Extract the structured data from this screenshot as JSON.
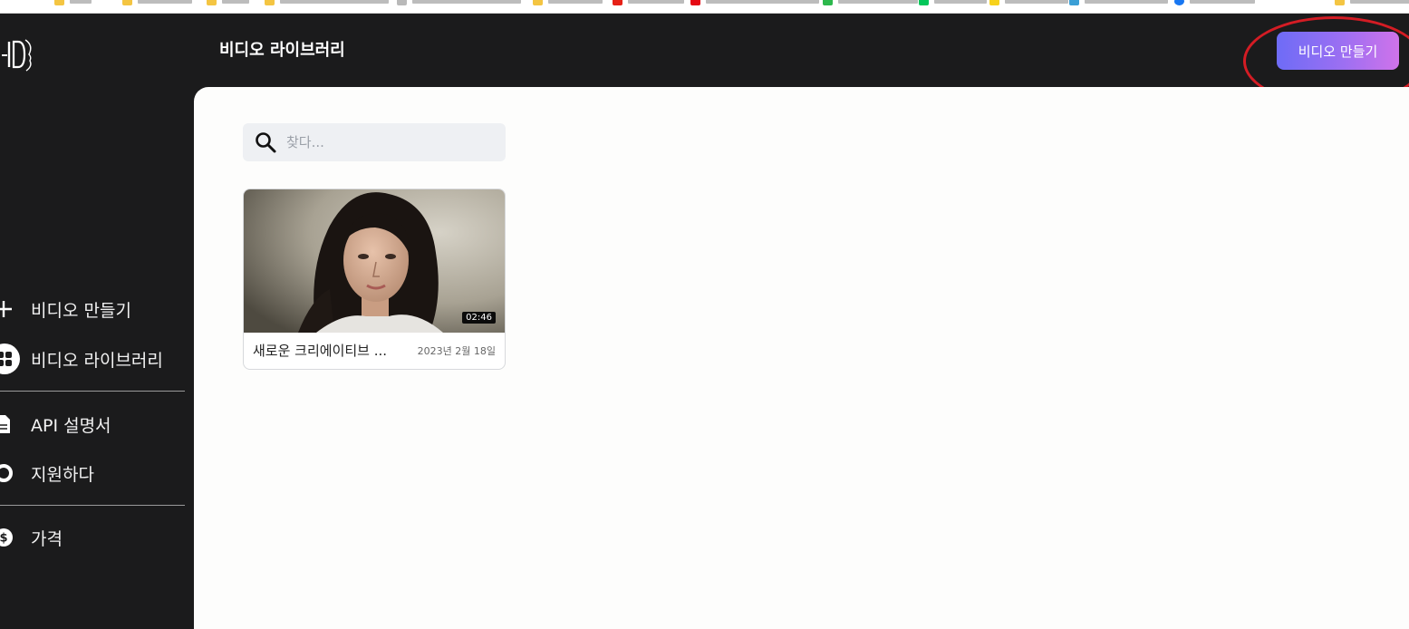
{
  "header": {
    "title": "비디오 라이브러리",
    "create_button": "비디오 만들기"
  },
  "sidebar": {
    "items": [
      {
        "label": "비디오 만들기",
        "icon": "plus-icon"
      },
      {
        "label": "비디오 라이브러리",
        "icon": "grid-icon"
      },
      {
        "label": "API 설명서",
        "icon": "document-icon"
      },
      {
        "label": "지원하다",
        "icon": "lifebuoy-icon"
      },
      {
        "label": "가격",
        "icon": "dollar-icon"
      }
    ]
  },
  "search": {
    "placeholder": "찾다..."
  },
  "videos": [
    {
      "title": "새로운 크리에이티브 ...",
      "date": "2023년 2월 18일",
      "duration": "02:46"
    }
  ],
  "colors": {
    "sidebar_bg": "#1b1b1c",
    "main_bg": "#fdfdfc",
    "button_gradient_start": "#6e6cf6",
    "button_gradient_end": "#cf73ea",
    "highlight_ring": "#d41c24"
  }
}
